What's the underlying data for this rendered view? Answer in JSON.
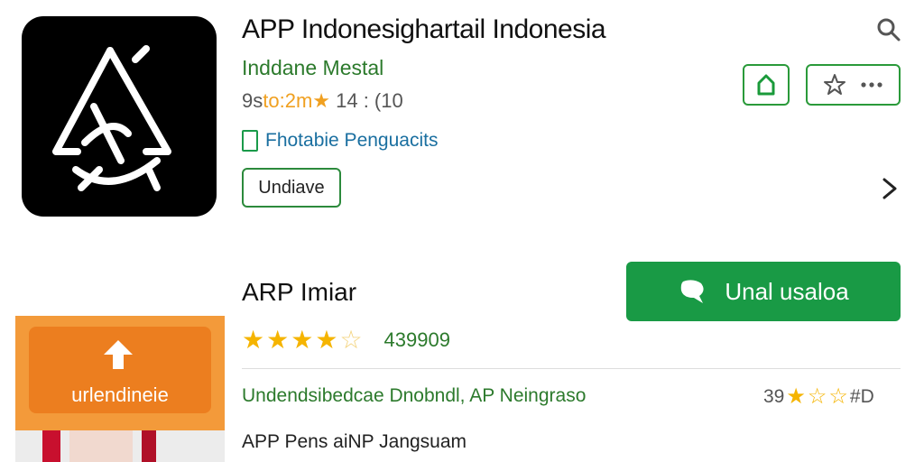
{
  "app": {
    "title": "APP Indonesighartail Indonesia",
    "developer": "Inddane Mestal",
    "meta_prefix": "9s",
    "meta_highlight": "to:2m★",
    "meta_suffix": " 14 : (10",
    "category": "Fhotabie Penguacits",
    "chip_label": "Undiave"
  },
  "section": {
    "title": "ARP Imiar",
    "install_label": "Unal usaloa",
    "rating_count": "439909",
    "description": "Undendsibedcae Dnobndl, AP Neingraso",
    "description_2": "APP Pens aiNP Jangsuam",
    "rating2_prefix": "39",
    "rating2_suffix": "#D"
  },
  "promo": {
    "label": "urlendineie"
  },
  "icons": {
    "search": "search-icon",
    "share": "share-icon",
    "wishlist": "star-outline-icon",
    "more": "more-dots-icon",
    "chevron": "chevron-right-icon"
  },
  "colors": {
    "accent_green": "#199a45",
    "star": "#f5b400",
    "promo_orange": "#ec7e1f"
  }
}
